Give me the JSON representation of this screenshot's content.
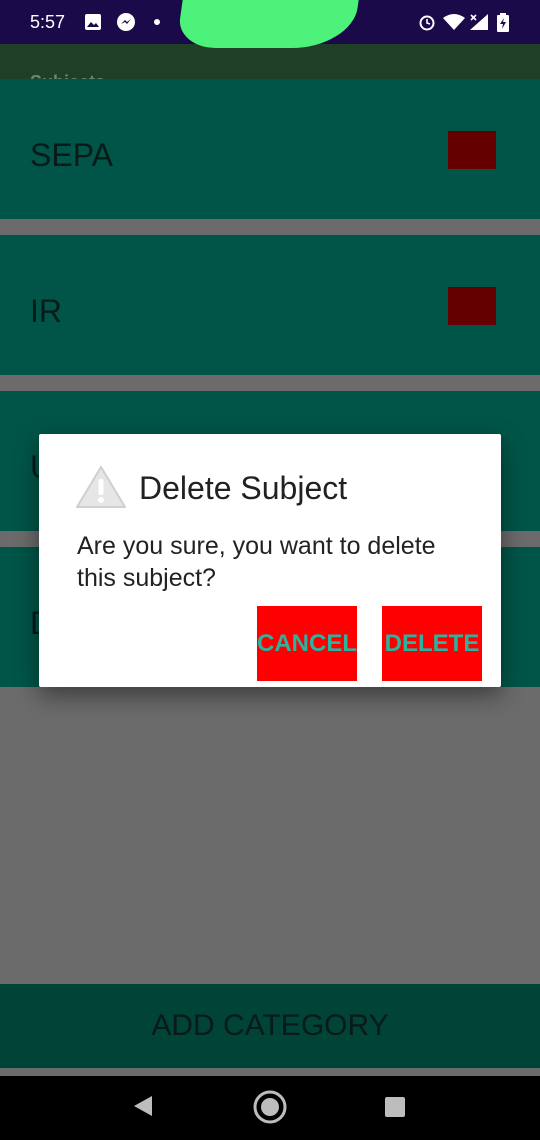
{
  "status_bar": {
    "time": "5:57",
    "icons_left": [
      "image-icon",
      "messenger-icon",
      "dot-icon"
    ],
    "icons_right": [
      "alarm-icon",
      "wifi-icon",
      "signal-icon",
      "battery-icon"
    ]
  },
  "app_bar": {
    "title": "Subjects"
  },
  "categories": [
    {
      "label": "SEPA",
      "color": "#640000"
    },
    {
      "label": "IR",
      "color": "#640000"
    },
    {
      "label": "U",
      "color": "#640000"
    },
    {
      "label": "D",
      "color": "#640000"
    }
  ],
  "add_category_label": "ADD CATEGORY",
  "dialog": {
    "title": "Delete Subject",
    "icon": "warning-icon",
    "message": "Are you sure, you want to delete this subject?",
    "cancel_label": "CANCEL",
    "delete_label": "DELETE",
    "button_color": "#ff0000",
    "button_text_color": "#2bb3a0"
  },
  "nav": {
    "back": "back-icon",
    "home": "home-icon",
    "recent": "recent-apps-icon"
  },
  "colors": {
    "card": "#005548",
    "background": "#6b6b6b",
    "status_bar": "#1a0a4a"
  }
}
